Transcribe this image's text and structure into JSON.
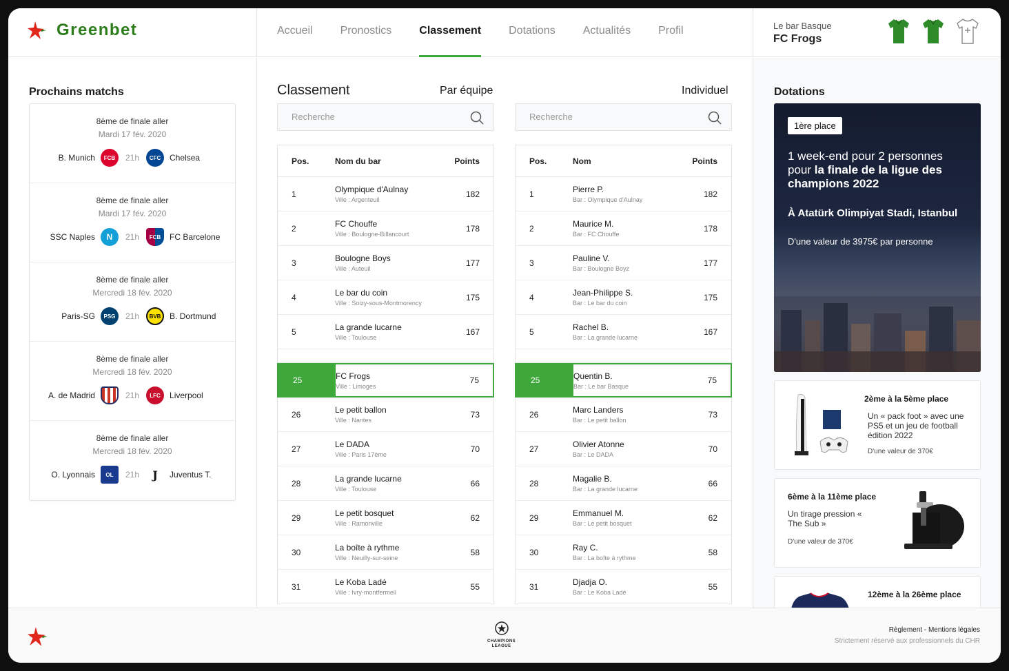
{
  "brand": {
    "name": "Greenbet"
  },
  "nav": {
    "items": [
      "Accueil",
      "Pronostics",
      "Classement",
      "Dotations",
      "Actualités",
      "Profil"
    ],
    "active": "Classement"
  },
  "user": {
    "bar": "Le bar Basque",
    "team": "FC Frogs"
  },
  "matches": {
    "title": "Prochains matchs",
    "items": [
      {
        "round": "8ème de finale aller",
        "date": "Mardi 17 fév. 2020",
        "home": "B. Munich",
        "time": "21h",
        "away": "Chelsea"
      },
      {
        "round": "8ème de finale aller",
        "date": "Mardi 17 fév. 2020",
        "home": "SSC Naples",
        "time": "21h",
        "away": "FC Barcelone"
      },
      {
        "round": "8ème de finale aller",
        "date": "Mercredi 18 fév. 2020",
        "home": "Paris-SG",
        "time": "21h",
        "away": "B. Dortmund"
      },
      {
        "round": "8ème de finale aller",
        "date": "Mercredi 18 fév. 2020",
        "home": "A. de Madrid",
        "time": "21h",
        "away": "Liverpool"
      },
      {
        "round": "8ème de finale aller",
        "date": "Mercredi 18 fév. 2020",
        "home": "O. Lyonnais",
        "time": "21h",
        "away": "Juventus T."
      }
    ]
  },
  "classement": {
    "title": "Classement",
    "tab_team": "Par équipe",
    "tab_individual": "Individuel",
    "search_placeholder": "Recherche",
    "team_headers": {
      "pos": "Pos.",
      "name": "Nom du bar",
      "points": "Points"
    },
    "ind_headers": {
      "pos": "Pos.",
      "name": "Nom",
      "points": "Points"
    },
    "team_top": [
      {
        "pos": "1",
        "name": "Olympique d'Aulnay",
        "sub": "Ville : Argenteuil",
        "pts": "182"
      },
      {
        "pos": "2",
        "name": "FC Chouffe",
        "sub": "Ville : Boulogne-Billancourt",
        "pts": "178"
      },
      {
        "pos": "3",
        "name": "Boulogne Boys",
        "sub": "Ville : Auteuil",
        "pts": "177"
      },
      {
        "pos": "4",
        "name": "Le bar du coin",
        "sub": "Ville : Soizy-sous-Montmorency",
        "pts": "175"
      },
      {
        "pos": "5",
        "name": "La grande lucarne",
        "sub": "Ville : Toulouse",
        "pts": "167"
      }
    ],
    "team_rest": [
      {
        "pos": "25",
        "name": "FC Frogs",
        "sub": "Ville : Limoges",
        "pts": "75"
      },
      {
        "pos": "26",
        "name": "Le petit ballon",
        "sub": "Ville : Nantes",
        "pts": "73"
      },
      {
        "pos": "27",
        "name": "Le DADA",
        "sub": "Ville : Paris 17ème",
        "pts": "70"
      },
      {
        "pos": "28",
        "name": "La grande lucarne",
        "sub": "Ville : Toulouse",
        "pts": "66"
      },
      {
        "pos": "29",
        "name": "Le petit bosquet",
        "sub": "Ville : Ramonville",
        "pts": "62"
      },
      {
        "pos": "30",
        "name": "La boîte à rythme",
        "sub": "Ville : Neuilly-sur-seine",
        "pts": "58"
      },
      {
        "pos": "31",
        "name": "Le Koba Ladé",
        "sub": "Ville : Ivry-montfermeil",
        "pts": "55"
      }
    ],
    "ind_top": [
      {
        "pos": "1",
        "name": "Pierre P.",
        "sub": "Bar : Olympique d'Aulnay",
        "pts": "182"
      },
      {
        "pos": "2",
        "name": "Maurice M.",
        "sub": "Bar : FC Chouffe",
        "pts": "178"
      },
      {
        "pos": "3",
        "name": "Pauline V.",
        "sub": "Bar : Boulogne Boyz",
        "pts": "177"
      },
      {
        "pos": "4",
        "name": "Jean-Philippe S.",
        "sub": "Bar : Le bar du coin",
        "pts": "175"
      },
      {
        "pos": "5",
        "name": "Rachel B.",
        "sub": "Bar : La grande lucarne",
        "pts": "167"
      }
    ],
    "ind_rest": [
      {
        "pos": "25",
        "name": "Quentin B.",
        "sub": "Bar : Le bar Basque",
        "pts": "75"
      },
      {
        "pos": "26",
        "name": "Marc Landers",
        "sub": "Bar : Le petit ballon",
        "pts": "73"
      },
      {
        "pos": "27",
        "name": "Olivier Atonne",
        "sub": "Bar : Le DADA",
        "pts": "70"
      },
      {
        "pos": "28",
        "name": "Magalie B.",
        "sub": "Bar : La grande lucarne",
        "pts": "66"
      },
      {
        "pos": "29",
        "name": "Emmanuel M.",
        "sub": "Bar : Le petit bosquet",
        "pts": "62"
      },
      {
        "pos": "30",
        "name": "Ray C.",
        "sub": "Bar : La boîte à rythme",
        "pts": "58"
      },
      {
        "pos": "31",
        "name": "Djadja O.",
        "sub": "Bar : Le Koba Ladé",
        "pts": "55"
      }
    ]
  },
  "dotations": {
    "title": "Dotations",
    "first": {
      "badge": "1ère place",
      "title_pre": "1 week-end pour 2 personnes pour ",
      "title_bold": "la finale de la ligue des champions 2022",
      "location": "À Atatürk Olimpiyat Stadi, Istanbul",
      "value": "D'une valeur de 3975€ par personne"
    },
    "second": {
      "title": "2ème à la 5ème place",
      "desc": "Un « pack foot » avec une PS5 et un jeu de football édition 2022",
      "value": "D'une valeur de 370€"
    },
    "third": {
      "title": "6ème à la 11ème place",
      "desc": "Un tirage pression « The Sub »",
      "value": "D'une valeur de 370€"
    },
    "fourth": {
      "title": "12ème à la 26ème place"
    }
  },
  "footer": {
    "links": "Règlement - Mentions légales",
    "note": "Strictement réservé aux professionnels du CHR",
    "cl_logo_line1": "CHAMPIONS",
    "cl_logo_line2": "LEAGUE"
  },
  "colors": {
    "brand_green": "#2d7d1c",
    "accent_green": "#3ea83b",
    "star_red": "#e1261c"
  }
}
